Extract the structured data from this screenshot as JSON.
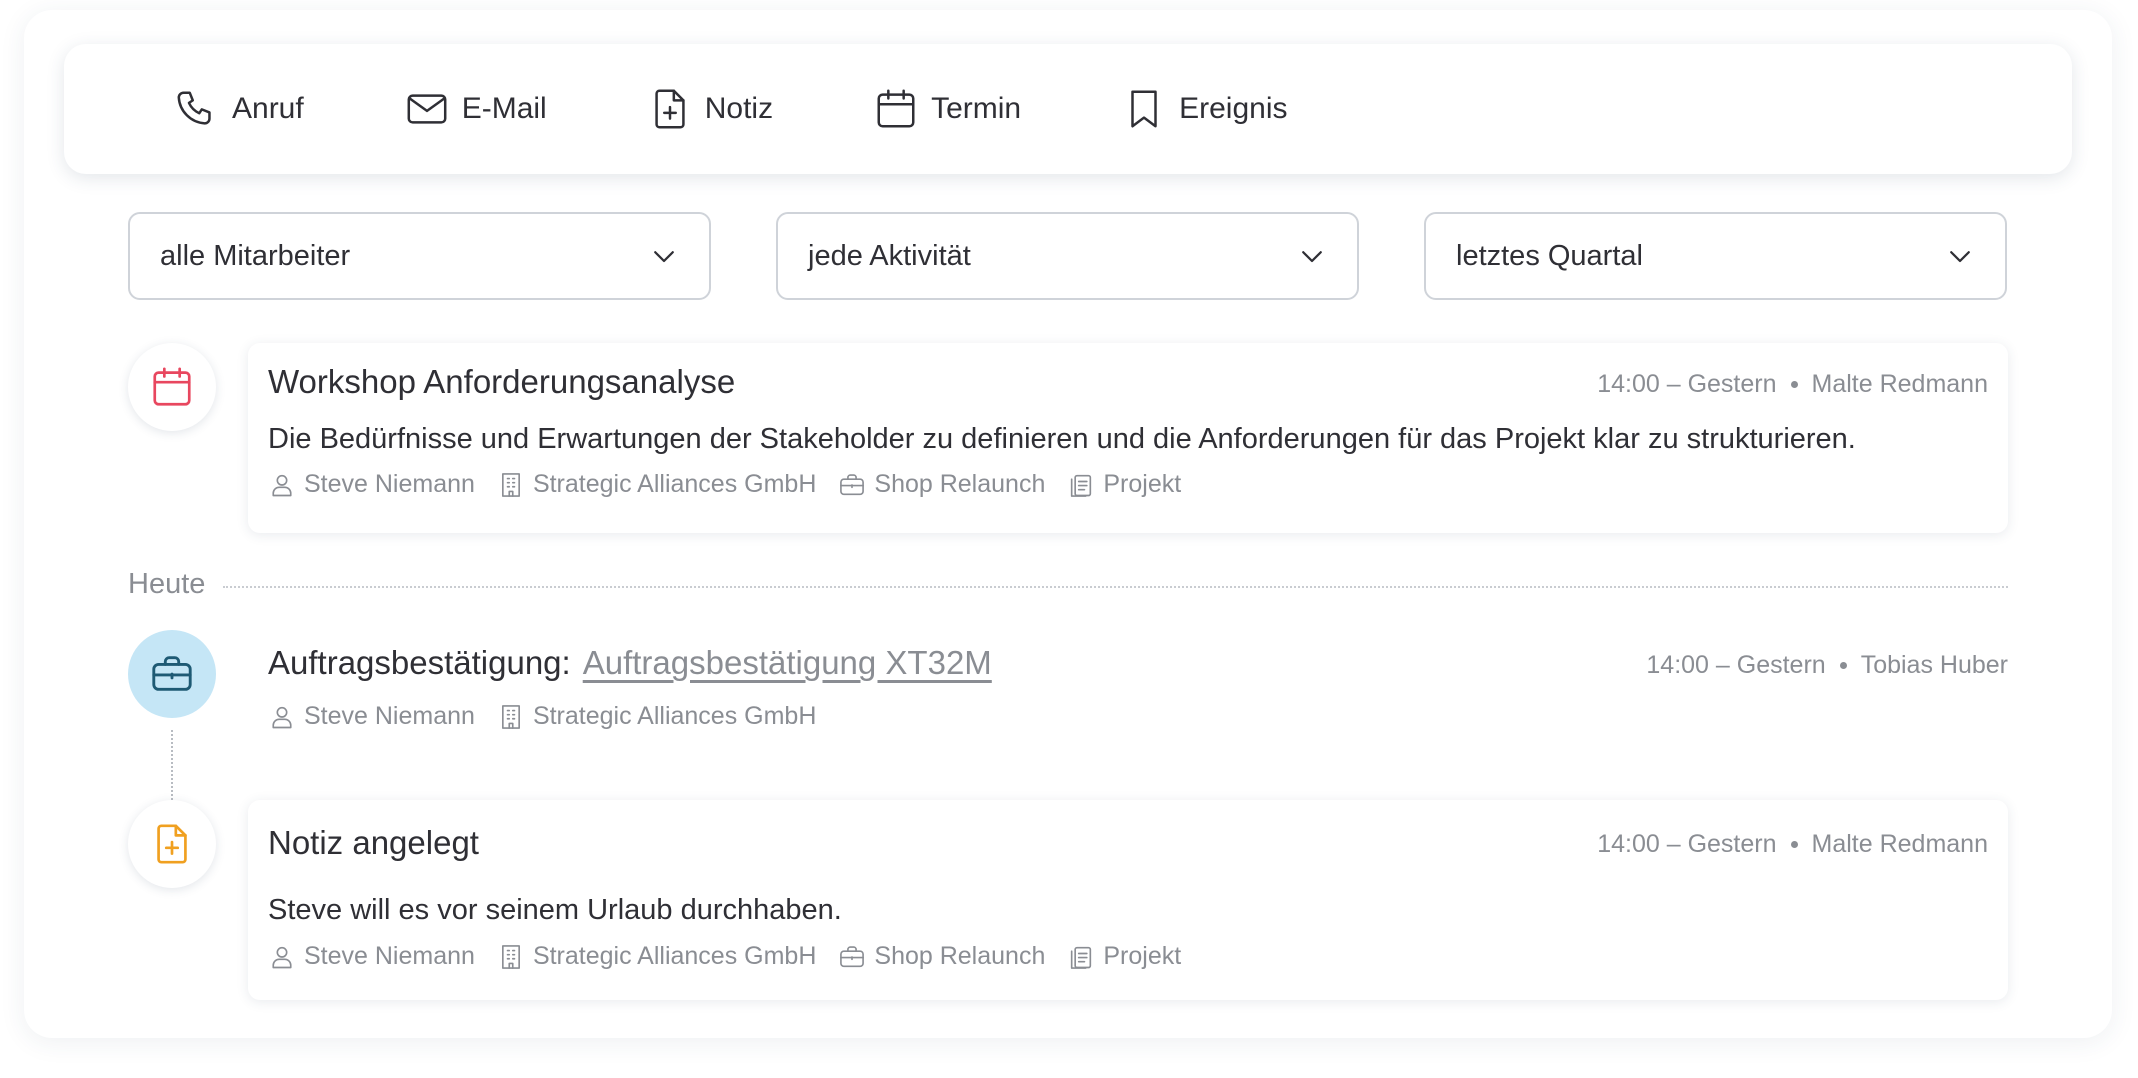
{
  "actions": [
    {
      "label": "Anruf",
      "icon": "phone-icon"
    },
    {
      "label": "E-Mail",
      "icon": "mail-icon"
    },
    {
      "label": "Notiz",
      "icon": "note-add-icon"
    },
    {
      "label": "Termin",
      "icon": "calendar-icon"
    },
    {
      "label": "Ereignis",
      "icon": "bookmark-icon"
    }
  ],
  "filters": {
    "employee": "alle Mitarbeiter",
    "activity": "jede Aktivität",
    "period": "letztes Quartal"
  },
  "colors": {
    "event_icon": "#e8475f",
    "order_icon": "#1e5a74",
    "order_circle": "#c5e6f6",
    "note_icon": "#f0a020"
  },
  "timeline": {
    "workshop": {
      "title": "Workshop Anforderungsanalyse",
      "time": "14:00 – Gestern",
      "user": "Malte Redmann",
      "description": "Die Bedürfnisse und Erwartungen der Stakeholder zu definieren und die Anforderungen für das Projekt klar zu strukturieren.",
      "contact": "Steve Niemann",
      "company": "Strategic Alliances GmbH",
      "deal": "Shop Relaunch",
      "type": "Projekt"
    },
    "divider_label": "Heute",
    "order": {
      "label": "Auftragsbestätigung:",
      "link": "Auftragsbestätigung XT32M",
      "time": "14:00 – Gestern",
      "user": "Tobias Huber",
      "contact": "Steve Niemann",
      "company": "Strategic Alliances GmbH"
    },
    "note": {
      "title": "Notiz angelegt",
      "time": "14:00 – Gestern",
      "user": "Malte Redmann",
      "description": "Steve will es vor seinem Urlaub durchhaben.",
      "contact": "Steve Niemann",
      "company": "Strategic Alliances GmbH",
      "deal": "Shop Relaunch",
      "type": "Projekt"
    }
  }
}
